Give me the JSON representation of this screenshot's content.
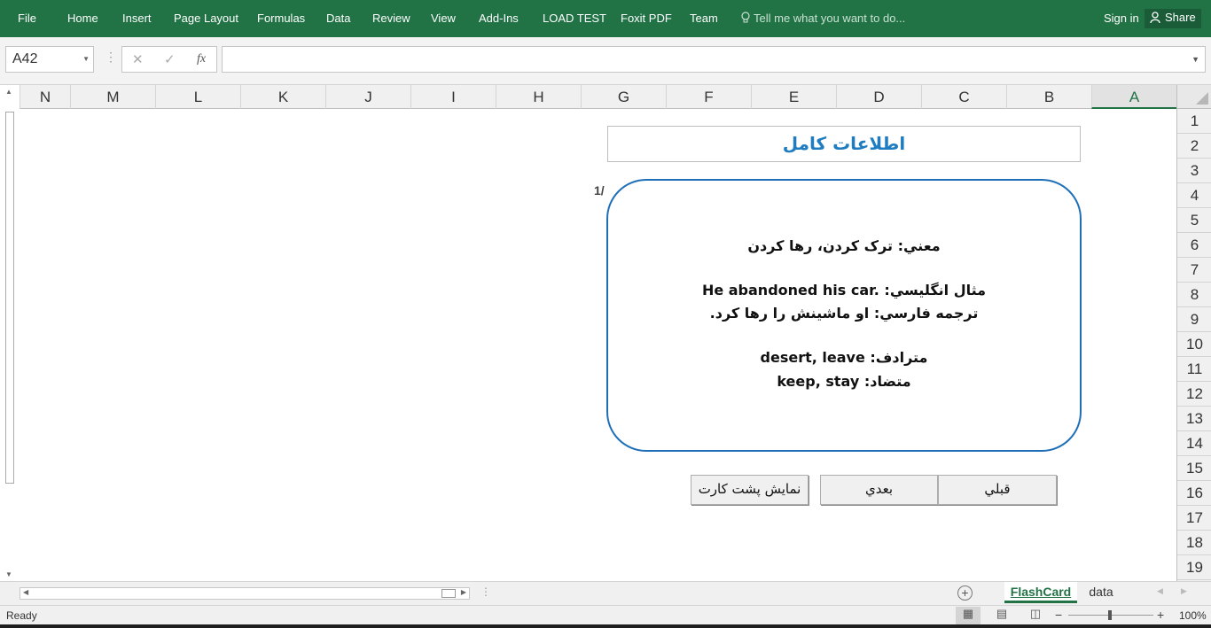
{
  "ribbon": {
    "tabs": [
      "File",
      "Home",
      "Insert",
      "Page Layout",
      "Formulas",
      "Data",
      "Review",
      "View",
      "Add-Ins",
      "LOAD TEST",
      "Foxit PDF",
      "Team"
    ],
    "tell_me": "Tell me what you want to do...",
    "sign_in": "Sign in",
    "share": "Share",
    "bg_color": "#217346"
  },
  "formula_bar": {
    "name_box": "A42",
    "cancel_icon": "✕",
    "enter_icon": "✓",
    "fx": "fx",
    "formula": ""
  },
  "columns": [
    "N",
    "M",
    "L",
    "K",
    "J",
    "I",
    "H",
    "G",
    "F",
    "E",
    "D",
    "C",
    "B",
    "A"
  ],
  "selected_column": "A",
  "rows": [
    "1",
    "2",
    "3",
    "4",
    "5",
    "6",
    "7",
    "8",
    "9",
    "10",
    "11",
    "12",
    "13",
    "14",
    "15",
    "16",
    "17",
    "18",
    "19"
  ],
  "flashcard": {
    "title": "اطلاعات کامل",
    "counter": "1/",
    "meaning": "معني: ترک کردن، رها کردن",
    "example_label": "مثال انگليسي:",
    "example_en": "He abandoned his car.",
    "translation": "ترجمه فارسي: او ماشينش را رها کرد.",
    "synonyms_label": "مترادف:",
    "synonyms": "desert, leave",
    "antonyms_label": "متضاد:",
    "antonyms": "keep, stay",
    "title_color": "#1f7cc0",
    "border_color": "#1f6fb8"
  },
  "buttons": {
    "prev": "قبلي",
    "next": "بعدي",
    "show_back": "نمايش پشت کارت"
  },
  "sheet_tabs": {
    "active": "FlashCard",
    "other": "data"
  },
  "status": {
    "ready": "Ready",
    "zoom": "100%"
  }
}
